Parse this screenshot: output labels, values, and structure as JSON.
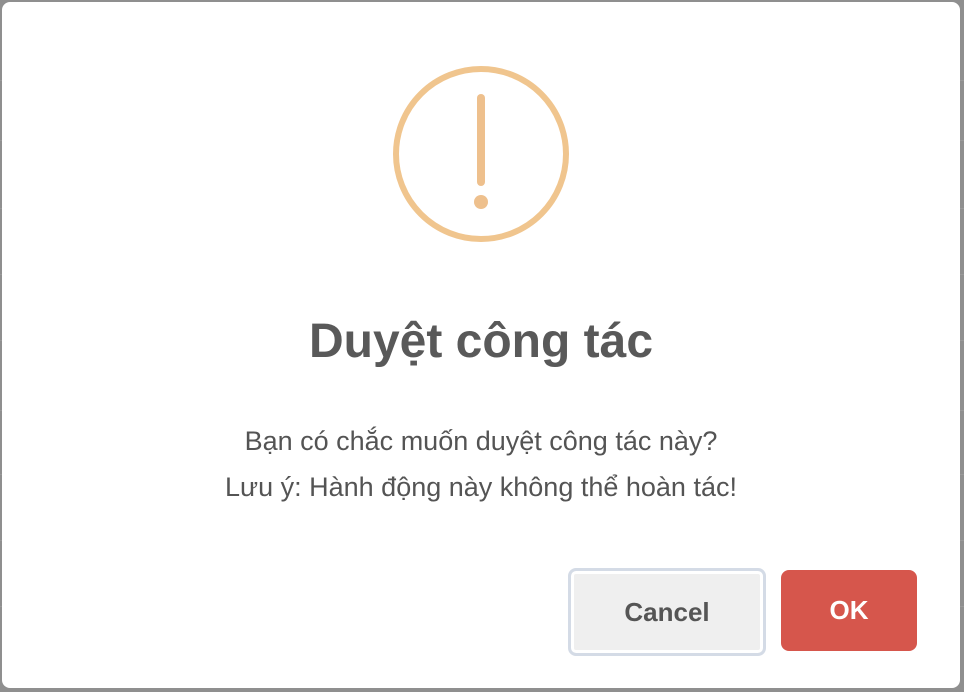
{
  "dialog": {
    "title": "Duyệt công tác",
    "message_line1": "Bạn có chắc muốn duyệt công tác này?",
    "message_line2": "Lưu ý: Hành động này không thể hoàn tác!",
    "icon": "warning-exclamation-icon",
    "cancel_label": "Cancel",
    "ok_label": "OK"
  },
  "colors": {
    "warning": "#f0c58e",
    "ok_button": "#d6564c",
    "cancel_button": "#efefef",
    "title_text": "#595959"
  }
}
